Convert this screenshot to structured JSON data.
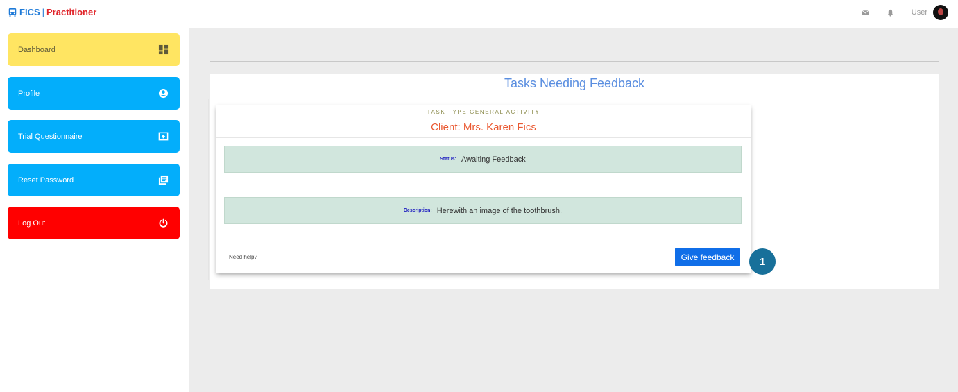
{
  "header": {
    "brand_name": "FICS",
    "brand_separator": "|",
    "brand_role": "Practitioner",
    "user_label": "User",
    "icons": [
      "bus-icon",
      "envelope-icon",
      "bell-icon",
      "avatar"
    ]
  },
  "sidebar": {
    "items": [
      {
        "label": "Dashboard",
        "icon": "dashboard-icon",
        "color": "#ffe562"
      },
      {
        "label": "Profile",
        "icon": "user-circle-icon",
        "color": "#03aefb"
      },
      {
        "label": "Trial Questionnaire",
        "icon": "upload-box-icon",
        "color": "#03aefb"
      },
      {
        "label": "Reset Password",
        "icon": "library-icon",
        "color": "#03aefb"
      },
      {
        "label": "Log Out",
        "icon": "power-icon",
        "color": "#ff0000"
      }
    ]
  },
  "main": {
    "title": "Tasks Needing Feedback",
    "card": {
      "task_type": "TASK TYPE GENERAL ACTIVITY",
      "client": "Client: Mrs. Karen Fics",
      "status_label": "Status:",
      "status_value": "Awaiting Feedback",
      "description_label": "Description:",
      "description_value": "Herewith an image of the toothbrush.",
      "help_text": "Need help?",
      "action_label": "Give feedback"
    },
    "step_badge": "1"
  }
}
